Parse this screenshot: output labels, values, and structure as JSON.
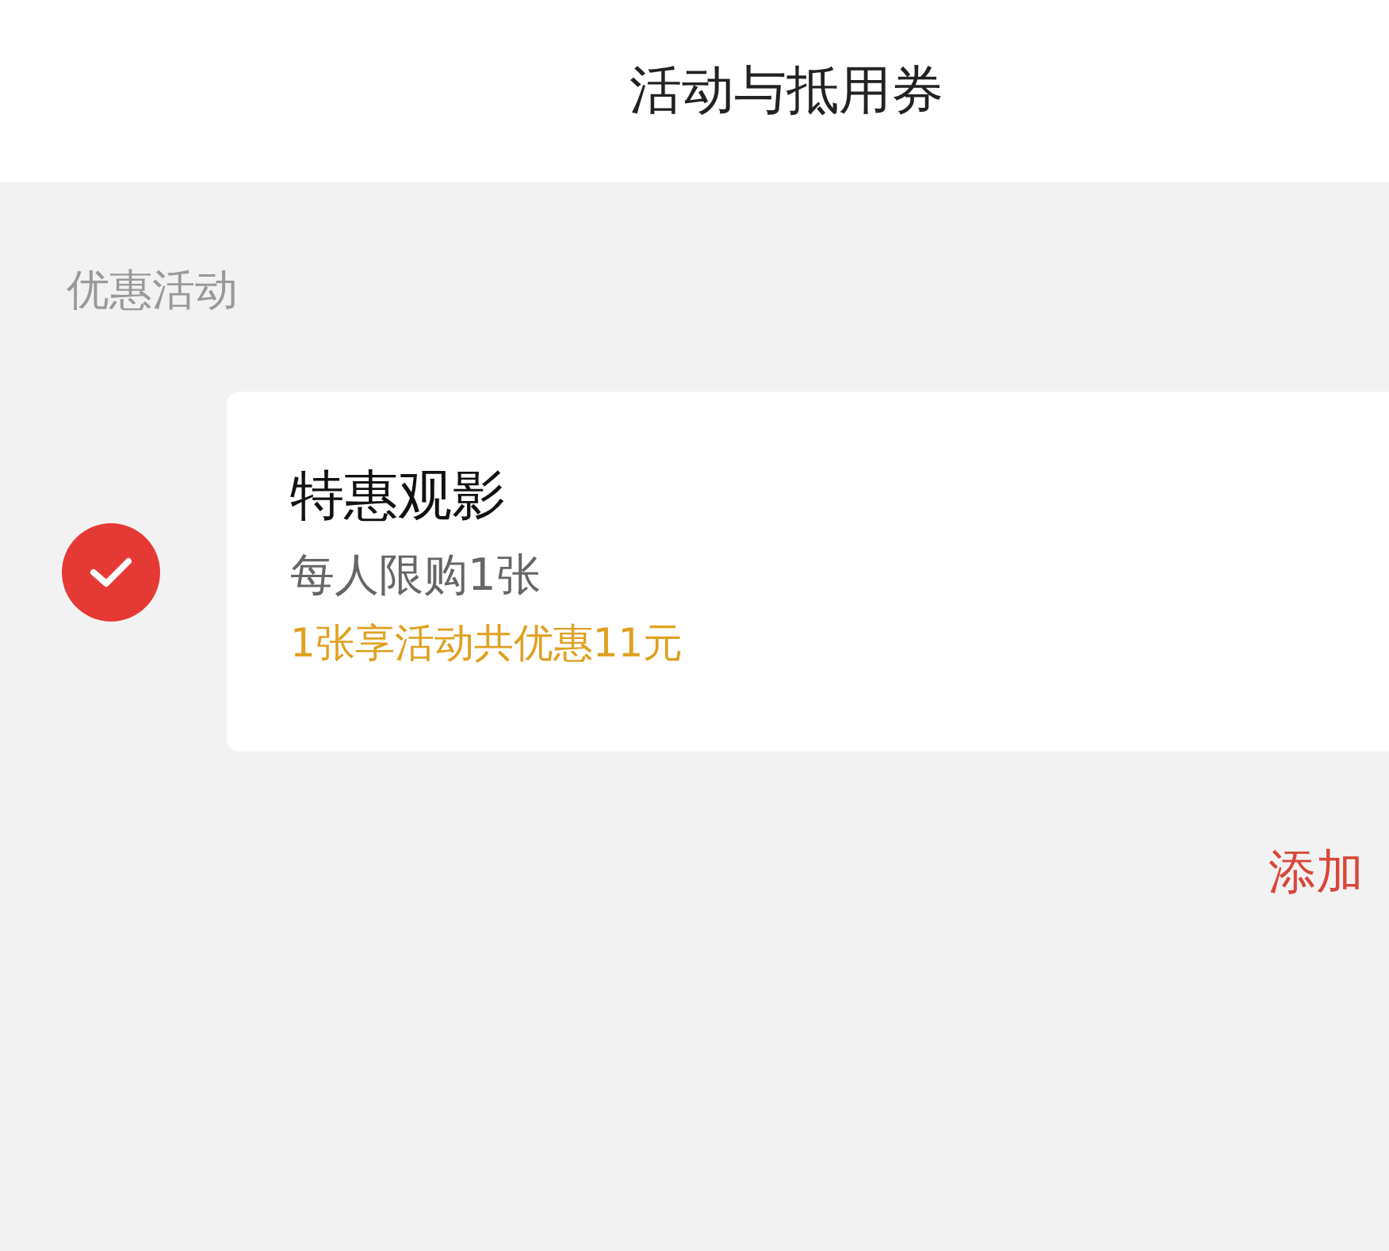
{
  "header": {
    "title": "活动与抵用券"
  },
  "section": {
    "label": "优惠活动"
  },
  "activities": [
    {
      "title": "特惠观影",
      "limit": "每人限购1张",
      "discount": "1张享活动共优惠11元",
      "checked": true
    }
  ],
  "add_link": "添加"
}
